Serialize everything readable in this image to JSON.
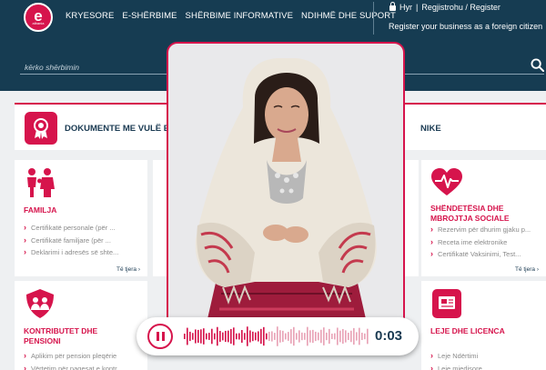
{
  "header": {
    "logo": {
      "letter": "e",
      "caption": "albania"
    },
    "nav": [
      "KRYESORE",
      "E-SHËRBIME",
      "SHËRBIME INFORMATIVE",
      "NDIHMË DHE SUPORT"
    ],
    "login_label": "Hyr",
    "separator": "|",
    "register_label": "Regjistrohu / Register",
    "foreign_link": "Register your business as a foreign citizen",
    "search_placeholder": "kërko shërbimin"
  },
  "banner": {
    "text": "DOKUMENTE ME VULË EL",
    "text_tail": "NIKE"
  },
  "cards": [
    {
      "title": "FAMILJA",
      "items": [
        "Certifikatë personale (për ...",
        "Certifikatë familjare (për ...",
        "Deklarimi i adresës së shte..."
      ],
      "more": "Të tjera"
    },
    {
      "title": "SHËNDETËSIA DHE MBROJTJA SOCIALE",
      "items": [
        "Rezervim për dhurim gjaku p...",
        "Receta ime elektronike",
        "Certifikatë Vaksinimi, Test..."
      ],
      "more": "Të tjera"
    },
    {
      "title": "KONTRIBUTET DHE PENSIONI",
      "items": [
        "Aplikim për pension pleqërie",
        "Vërtetim për pagesat e kontr..."
      ]
    },
    {
      "title": "LEJE DHE LICENCA",
      "items": [
        "Leje Ndërtimi",
        "Leje mjedisore"
      ]
    }
  ],
  "player": {
    "time": "0:03",
    "progress": 0.45
  },
  "colors": {
    "brand": "#d6144c",
    "header": "#163c52"
  },
  "icons": [
    "search-icon",
    "certificate-icon",
    "family-icon",
    "heart-pulse-icon",
    "contributions-icon",
    "license-icon",
    "pause-icon"
  ]
}
